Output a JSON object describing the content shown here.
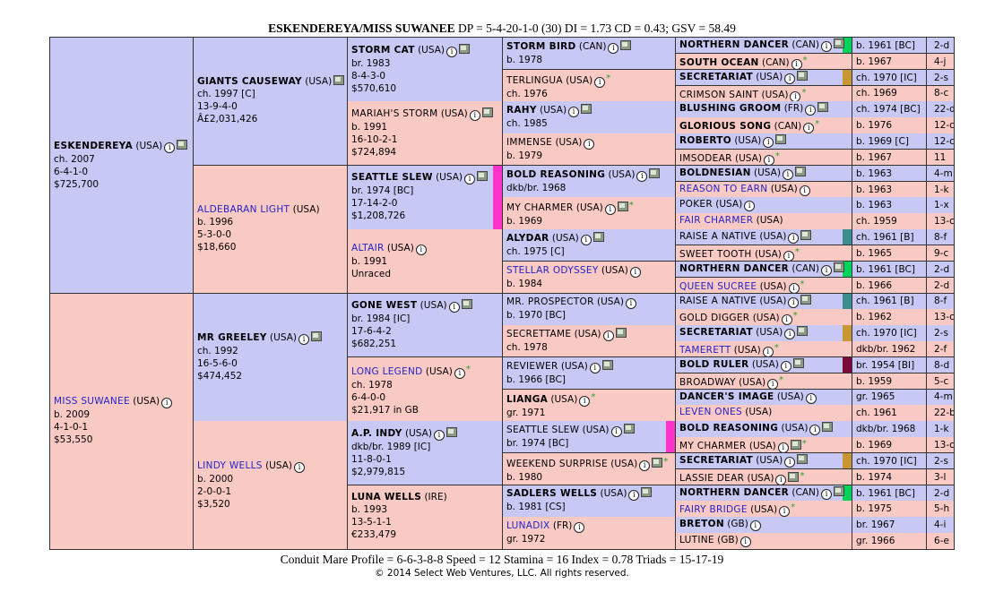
{
  "header": {
    "title_bold": "ESKENDEREYA/MISS SUWANEE",
    "title_rest": " DP = 5-4-20-1-0 (30) DI = 1.73   CD = 0.43; GSV = 58.49"
  },
  "footer": {
    "profile": "Conduit Mare Profile = 6-6-3-8-8   Speed = 12   Stamina = 16   Index = 0.78   Triads = 15-17-19",
    "copyright": "© 2014 Select Web Ventures, LLC. All rights reserved."
  },
  "colors": {
    "male": "#c8c8f5",
    "female": "#f9c9c4",
    "green_bar": "#00d25a",
    "gold_bar": "#c89632",
    "magenta_bar": "#ff33cc",
    "teal_bar": "#3b8e8e",
    "maroon_bar": "#7a0a3a"
  },
  "gen1": [
    {
      "name": "ESKENDEREYA",
      "country": " (USA)",
      "lines": [
        "ch. 2007",
        "6-4-1-0",
        "$725,700"
      ],
      "sex": "m",
      "info": true,
      "photo": true
    },
    {
      "name": "MISS SUWANEE",
      "country": " (USA)",
      "lines": [
        "b. 2009",
        "4-1-0-1",
        "$53,550"
      ],
      "sex": "f",
      "info": true,
      "link": true
    }
  ],
  "gen2": [
    {
      "name": "GIANTS CAUSEWAY",
      "country": " (USA)",
      "lines": [
        "ch. 1997 [C]",
        "13-9-4-0",
        "Â£2,031,426"
      ],
      "sex": "m",
      "photo": true
    },
    {
      "name": "ALDEBARAN LIGHT",
      "country": " (USA)",
      "lines": [
        "b. 1996",
        "5-3-0-0",
        "$18,660"
      ],
      "sex": "f",
      "link": true
    },
    {
      "name": "MR GREELEY",
      "country": " (USA)",
      "lines": [
        "ch. 1992",
        "16-5-6-0",
        "$474,452"
      ],
      "sex": "m",
      "info": true,
      "photo": true
    },
    {
      "name": "LINDY WELLS",
      "country": " (USA)",
      "lines": [
        "b. 2000",
        "2-0-0-1",
        "$3,520"
      ],
      "sex": "f",
      "link": true,
      "info": true
    }
  ],
  "gen3": [
    {
      "name": "STORM CAT",
      "country": " (USA)",
      "lines": [
        "br. 1983",
        "8-4-3-0",
        "$570,610"
      ],
      "sex": "m",
      "info": true,
      "photo": true
    },
    {
      "name": "MARIAH'S STORM",
      "country": " (USA)",
      "lines": [
        "b. 1991",
        "16-10-2-1",
        "$724,894"
      ],
      "sex": "f",
      "plain": true,
      "info": true,
      "photo": true
    },
    {
      "name": "SEATTLE SLEW",
      "country": " (USA)",
      "lines": [
        "br. 1974 [BC]",
        "17-14-2-0",
        "$1,208,726"
      ],
      "sex": "m",
      "info": true,
      "photo": true,
      "bar": "magenta_bar"
    },
    {
      "name": "ALTAIR",
      "country": " (USA)",
      "lines": [
        "b. 1991",
        "Unraced"
      ],
      "sex": "f",
      "link": true,
      "info": true
    },
    {
      "name": "GONE WEST",
      "country": " (USA)",
      "lines": [
        "br. 1984 [IC]",
        "17-6-4-2",
        "$682,251"
      ],
      "sex": "m",
      "info": true,
      "photo": true
    },
    {
      "name": "LONG LEGEND",
      "country": " (USA)",
      "lines": [
        "ch. 1978",
        "6-4-0-0",
        "$21,917 in GB"
      ],
      "sex": "f",
      "link": true,
      "info": true,
      "star": true
    },
    {
      "name": "A.P. INDY",
      "country": " (USA)",
      "lines": [
        "dkb/br. 1989 [IC]",
        "11-8-0-1",
        "$2,979,815"
      ],
      "sex": "m",
      "info": true,
      "photo": true
    },
    {
      "name": "LUNA WELLS",
      "country": " (IRE)",
      "lines": [
        "b. 1993",
        "13-5-1-1",
        "€233,479"
      ],
      "sex": "f"
    }
  ],
  "gen4": [
    {
      "name": "STORM BIRD",
      "country": " (CAN)",
      "lines": [
        "b. 1978"
      ],
      "sex": "m",
      "info": true,
      "photo": true
    },
    {
      "name": "TERLINGUA",
      "country": " (USA)",
      "lines": [
        "ch. 1976"
      ],
      "sex": "f",
      "plain": true,
      "info": true,
      "star": true
    },
    {
      "name": "RAHY",
      "country": " (USA)",
      "lines": [
        "ch. 1985"
      ],
      "sex": "m",
      "info": true,
      "photo": true
    },
    {
      "name": "IMMENSE",
      "country": " (USA)",
      "lines": [
        "b. 1979"
      ],
      "sex": "f",
      "plain": true,
      "info": true
    },
    {
      "name": "BOLD REASONING",
      "country": " (USA)",
      "lines": [
        "dkb/br. 1968"
      ],
      "sex": "m",
      "info": true,
      "photo": true
    },
    {
      "name": "MY CHARMER",
      "country": " (USA)",
      "lines": [
        "b. 1969"
      ],
      "sex": "f",
      "plain": true,
      "info": true,
      "photo": true,
      "star": true
    },
    {
      "name": "ALYDAR",
      "country": " (USA)",
      "lines": [
        "ch. 1975 [C]"
      ],
      "sex": "m",
      "info": true,
      "photo": true
    },
    {
      "name": "STELLAR ODYSSEY",
      "country": " (USA)",
      "lines": [
        "b. 1984"
      ],
      "sex": "f",
      "link": true,
      "info": true
    },
    {
      "name": "MR. PROSPECTOR",
      "country": " (USA)",
      "lines": [
        "b. 1970 [BC]"
      ],
      "sex": "m",
      "plain": true,
      "info": true
    },
    {
      "name": "SECRETTAME",
      "country": " (USA)",
      "lines": [
        "ch. 1978"
      ],
      "sex": "f",
      "plain": true,
      "info": true,
      "photo": true
    },
    {
      "name": "REVIEWER",
      "country": " (USA)",
      "lines": [
        "b. 1966 [BC]"
      ],
      "sex": "m",
      "plain": true,
      "info": true,
      "photo": true
    },
    {
      "name": "LIANGA",
      "country": " (USA)",
      "lines": [
        "gr. 1971"
      ],
      "sex": "f",
      "info": true,
      "star": true
    },
    {
      "name": "SEATTLE SLEW",
      "country": " (USA)",
      "lines": [
        "br. 1974 [BC]"
      ],
      "sex": "m",
      "plain": true,
      "info": true,
      "photo": true,
      "bar": "magenta_bar"
    },
    {
      "name": "WEEKEND SURPRISE",
      "country": " (USA)",
      "lines": [
        "b. 1980"
      ],
      "sex": "f",
      "plain": true,
      "info": true,
      "photo": true,
      "star": true
    },
    {
      "name": "SADLERS WELLS",
      "country": " (USA)",
      "lines": [
        "b. 1981 [CS]"
      ],
      "sex": "m",
      "info": true,
      "photo": true
    },
    {
      "name": "LUNADIX",
      "country": " (FR)",
      "lines": [
        "gr. 1972"
      ],
      "sex": "f",
      "link": true,
      "info": true
    }
  ],
  "gen5": [
    {
      "name": "NORTHERN DANCER",
      "country": " (CAN)",
      "sex": "m",
      "info": true,
      "photo": true,
      "bar": "green_bar",
      "dob": "b. 1961 [BC]",
      "rec": "2-d"
    },
    {
      "name": "SOUTH OCEAN",
      "country": " (CAN)",
      "sex": "f",
      "info": true,
      "star": true,
      "dob": "b. 1967",
      "rec": "4-j"
    },
    {
      "name": "SECRETARIAT",
      "country": " (USA)",
      "sex": "m",
      "info": true,
      "photo": true,
      "bar": "gold_bar",
      "dob": "ch. 1970 [IC]",
      "rec": "2-s"
    },
    {
      "name": "CRIMSON SAINT",
      "country": " (USA)",
      "sex": "f",
      "plain": true,
      "info": true,
      "star": true,
      "dob": "ch. 1969",
      "rec": "8-c"
    },
    {
      "name": "BLUSHING GROOM",
      "country": " (FR)",
      "sex": "m",
      "info": true,
      "photo": true,
      "dob": "ch. 1974 [BC]",
      "rec": "22-d"
    },
    {
      "name": "GLORIOUS SONG",
      "country": " (CAN)",
      "sex": "f",
      "info": true,
      "star": true,
      "dob": "b. 1976",
      "rec": "12-c"
    },
    {
      "name": "ROBERTO",
      "country": " (USA)",
      "sex": "m",
      "info": true,
      "photo": true,
      "dob": "b. 1969 [C]",
      "rec": "12-c"
    },
    {
      "name": "IMSODEAR",
      "country": " (USA)",
      "sex": "f",
      "plain": true,
      "info": true,
      "star": true,
      "dob": "b. 1967",
      "rec": "11"
    },
    {
      "name": "BOLDNESIAN",
      "country": " (USA)",
      "sex": "m",
      "info": true,
      "photo": true,
      "dob": "b. 1963",
      "rec": "4-m"
    },
    {
      "name": "REASON TO EARN",
      "country": " (USA)",
      "sex": "f",
      "link": true,
      "info": true,
      "dob": "b. 1963",
      "rec": "1-k"
    },
    {
      "name": "POKER",
      "country": " (USA)",
      "sex": "m",
      "plain": true,
      "info": true,
      "dob": "b. 1963",
      "rec": "1-x"
    },
    {
      "name": "FAIR CHARMER",
      "country": " (USA)",
      "sex": "f",
      "link": true,
      "dob": "ch. 1959",
      "rec": "13-c"
    },
    {
      "name": "RAISE A NATIVE",
      "country": " (USA)",
      "sex": "m",
      "plain": true,
      "info": true,
      "photo": true,
      "bar": "teal_bar",
      "dob": "ch. 1961 [B]",
      "rec": "8-f"
    },
    {
      "name": "SWEET TOOTH",
      "country": " (USA)",
      "sex": "f",
      "plain": true,
      "info": true,
      "star": true,
      "dob": "b. 1965",
      "rec": "9-c"
    },
    {
      "name": "NORTHERN DANCER",
      "country": " (CAN)",
      "sex": "m",
      "info": true,
      "photo": true,
      "bar": "green_bar",
      "dob": "b. 1961 [BC]",
      "rec": "2-d"
    },
    {
      "name": "QUEEN SUCREE",
      "country": " (USA)",
      "sex": "f",
      "link": true,
      "info": true,
      "star": true,
      "dob": "b. 1966",
      "rec": "2-d"
    },
    {
      "name": "RAISE A NATIVE",
      "country": " (USA)",
      "sex": "m",
      "plain": true,
      "info": true,
      "photo": true,
      "bar": "teal_bar",
      "dob": "ch. 1961 [B]",
      "rec": "8-f"
    },
    {
      "name": "GOLD DIGGER",
      "country": " (USA)",
      "sex": "f",
      "plain": true,
      "info": true,
      "star": true,
      "dob": "b. 1962",
      "rec": "13-c"
    },
    {
      "name": "SECRETARIAT",
      "country": " (USA)",
      "sex": "m",
      "info": true,
      "photo": true,
      "bar": "gold_bar",
      "dob": "ch. 1970 [IC]",
      "rec": "2-s"
    },
    {
      "name": "TAMERETT",
      "country": " (USA)",
      "sex": "f",
      "link": true,
      "info": true,
      "star": true,
      "dob": "dkb/br. 1962",
      "rec": "2-f"
    },
    {
      "name": "BOLD RULER",
      "country": " (USA)",
      "sex": "m",
      "info": true,
      "photo": true,
      "bar": "maroon_bar",
      "dob": "br. 1954 [BI]",
      "rec": "8-d"
    },
    {
      "name": "BROADWAY",
      "country": " (USA)",
      "sex": "f",
      "plain": true,
      "info": true,
      "star": true,
      "dob": "b. 1959",
      "rec": "5-c"
    },
    {
      "name": "DANCER'S IMAGE",
      "country": " (USA)",
      "sex": "m",
      "info": true,
      "dob": "gr. 1965",
      "rec": "4-m"
    },
    {
      "name": "LEVEN ONES",
      "country": " (USA)",
      "sex": "f",
      "link": true,
      "dob": "ch. 1961",
      "rec": "22-b"
    },
    {
      "name": "BOLD REASONING",
      "country": " (USA)",
      "sex": "m",
      "info": true,
      "photo": true,
      "dob": "dkb/br. 1968",
      "rec": "1-k"
    },
    {
      "name": "MY CHARMER",
      "country": " (USA)",
      "sex": "f",
      "plain": true,
      "info": true,
      "photo": true,
      "star": true,
      "dob": "b. 1969",
      "rec": "13-c"
    },
    {
      "name": "SECRETARIAT",
      "country": " (USA)",
      "sex": "m",
      "info": true,
      "photo": true,
      "bar": "gold_bar",
      "dob": "ch. 1970 [IC]",
      "rec": "2-s"
    },
    {
      "name": "LASSIE DEAR",
      "country": " (USA)",
      "sex": "f",
      "plain": true,
      "info": true,
      "photo": true,
      "star": true,
      "dob": "b. 1974",
      "rec": "3-l"
    },
    {
      "name": "NORTHERN DANCER",
      "country": " (CAN)",
      "sex": "m",
      "info": true,
      "photo": true,
      "bar": "green_bar",
      "dob": "b. 1961 [BC]",
      "rec": "2-d"
    },
    {
      "name": "FAIRY BRIDGE",
      "country": " (USA)",
      "sex": "f",
      "link": true,
      "info": true,
      "star": true,
      "dob": "b. 1975",
      "rec": "5-h"
    },
    {
      "name": "BRETON",
      "country": " (GB)",
      "sex": "m",
      "info": true,
      "dob": "br. 1967",
      "rec": "4-i"
    },
    {
      "name": "LUTINE",
      "country": " (GB)",
      "sex": "f",
      "plain": true,
      "info": true,
      "dob": "gr. 1966",
      "rec": "6-e"
    }
  ]
}
